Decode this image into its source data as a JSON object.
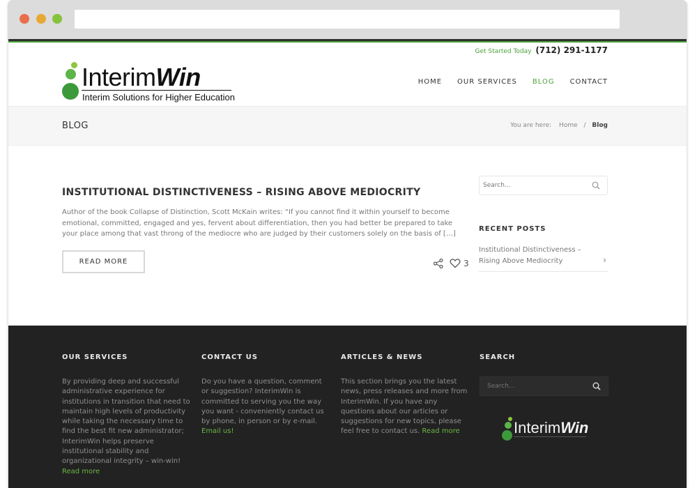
{
  "topbar": {
    "cta": "Get Started Today",
    "phone": "(712) 291-1177"
  },
  "logo": {
    "word_regular": "Interim",
    "word_bold": "Win",
    "tagline": "Interim Solutions for Higher Education"
  },
  "nav": {
    "items": [
      {
        "label": "HOME"
      },
      {
        "label": "OUR SERVICES"
      },
      {
        "label": "BLOG"
      },
      {
        "label": "CONTACT"
      }
    ],
    "active": "BLOG",
    "accent": "#4aa23a"
  },
  "titlebar": {
    "title": "BLOG",
    "breadcrumb": {
      "prefix": "You are here:",
      "home": "Home",
      "separator": "/",
      "current": "Blog"
    }
  },
  "post": {
    "title": "INSTITUTIONAL DISTINCTIVENESS – RISING ABOVE MEDIOCRITY",
    "excerpt": "Author of the book Collapse of Distinction, Scott McKain writes:  “If you cannot find it within yourself to become emotional, committed, engaged and yes, fervent about differentiation, then you had better be prepared to take your place among that vast throng of the mediocre who are judged by their customers solely on the basis of […]",
    "read_more": "READ MORE",
    "likes": "3",
    "icons": {
      "share": "share-icon",
      "like": "heart-icon"
    }
  },
  "sidebar": {
    "search_placeholder": "Search...",
    "recent_title": "RECENT POSTS",
    "recent_posts": [
      {
        "label": "Institutional Distinctiveness – Rising Above Mediocrity"
      }
    ]
  },
  "footer": {
    "services": {
      "title": "OUR SERVICES",
      "text": "By providing deep and successful administrative experience for institutions in transition that need to maintain high levels of productivity while taking the necessary time to find the best fit new administrator; InterimWin helps preserve institutional stability and organizational integrity – win-win!",
      "link": "Read more"
    },
    "contact": {
      "title": "CONTACT US",
      "text": "Do you have a question, comment or suggestion? InterimWin is committed to serving you the way you want - conveniently contact us by phone, in person or by e-mail.",
      "link": "Email us!"
    },
    "articles": {
      "title": "ARTICLES & NEWS",
      "text": "This section brings you the latest news, press releases and more from InterimWin. If you have any questions about our articles or suggestions for new topics, please feel free to contact us.",
      "link": "Read more"
    },
    "search": {
      "title": "SEARCH",
      "placeholder": "Search...",
      "logo_regular": "Interim",
      "logo_bold": "Win"
    }
  }
}
